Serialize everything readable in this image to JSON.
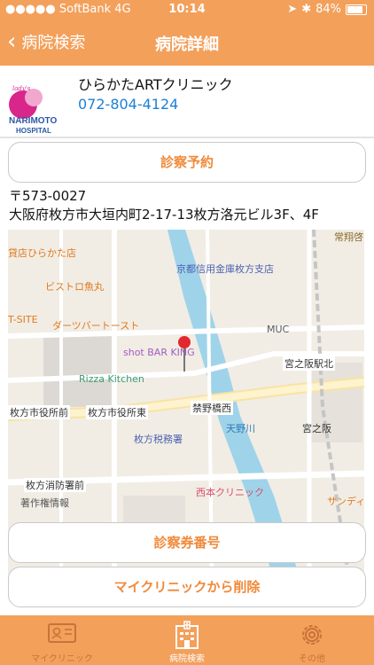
{
  "status": {
    "carrier": "●●●●● SoftBank  4G",
    "time": "10:14",
    "battery": "84%",
    "battery_level": 0.84
  },
  "nav": {
    "back_label": "病院検索",
    "title": "病院詳細"
  },
  "clinic": {
    "logo_script": "lady's",
    "logo_name": "NARIMOTO",
    "logo_sub": "HOSPITAL",
    "name": "ひらかたARTクリニック",
    "phone": "072-804-4124",
    "postal": "〒573-0027",
    "address": "大阪府枚方市大垣内町2-17-13枚方洛元ビル3F、4F"
  },
  "buttons": {
    "reserve": "診察予約",
    "card_number": "診察券番号",
    "remove": "マイクリニックから削除"
  },
  "map": {
    "labels": {
      "store": "貸店ひらかた店",
      "bistro": "ビストロ魚丸",
      "t_site": "T-SITE",
      "darts": "ダーツバートースト",
      "bank": "京都信用金庫枚方支店",
      "muc": "MUC",
      "bar": "shot BAR KING",
      "rizza": "Rizza Kitchen",
      "miyanosaka_n": "宮之阪駅北",
      "kinya": "禁野橋西",
      "amano": "天野川",
      "miyanosaka": "宮之阪",
      "city_hall_front": "枚方市役所前",
      "city_hall_east": "枚方市役所東",
      "tax_office": "枚方税務署",
      "fire_dept": "枚方消防署前",
      "nishimoto": "西本クリニック",
      "copyright": "著作権情報",
      "sunday": "サンディ",
      "top_right": "常翔啓"
    }
  },
  "tabs": [
    {
      "label": "マイクリニック",
      "icon": "id-card-icon"
    },
    {
      "label": "病院検索",
      "icon": "hospital-building-icon"
    },
    {
      "label": "その他",
      "icon": "gear-icon"
    }
  ],
  "colors": {
    "accent": "#f3a05b",
    "button_text": "#f08a3a",
    "link": "#1d7fd6"
  }
}
